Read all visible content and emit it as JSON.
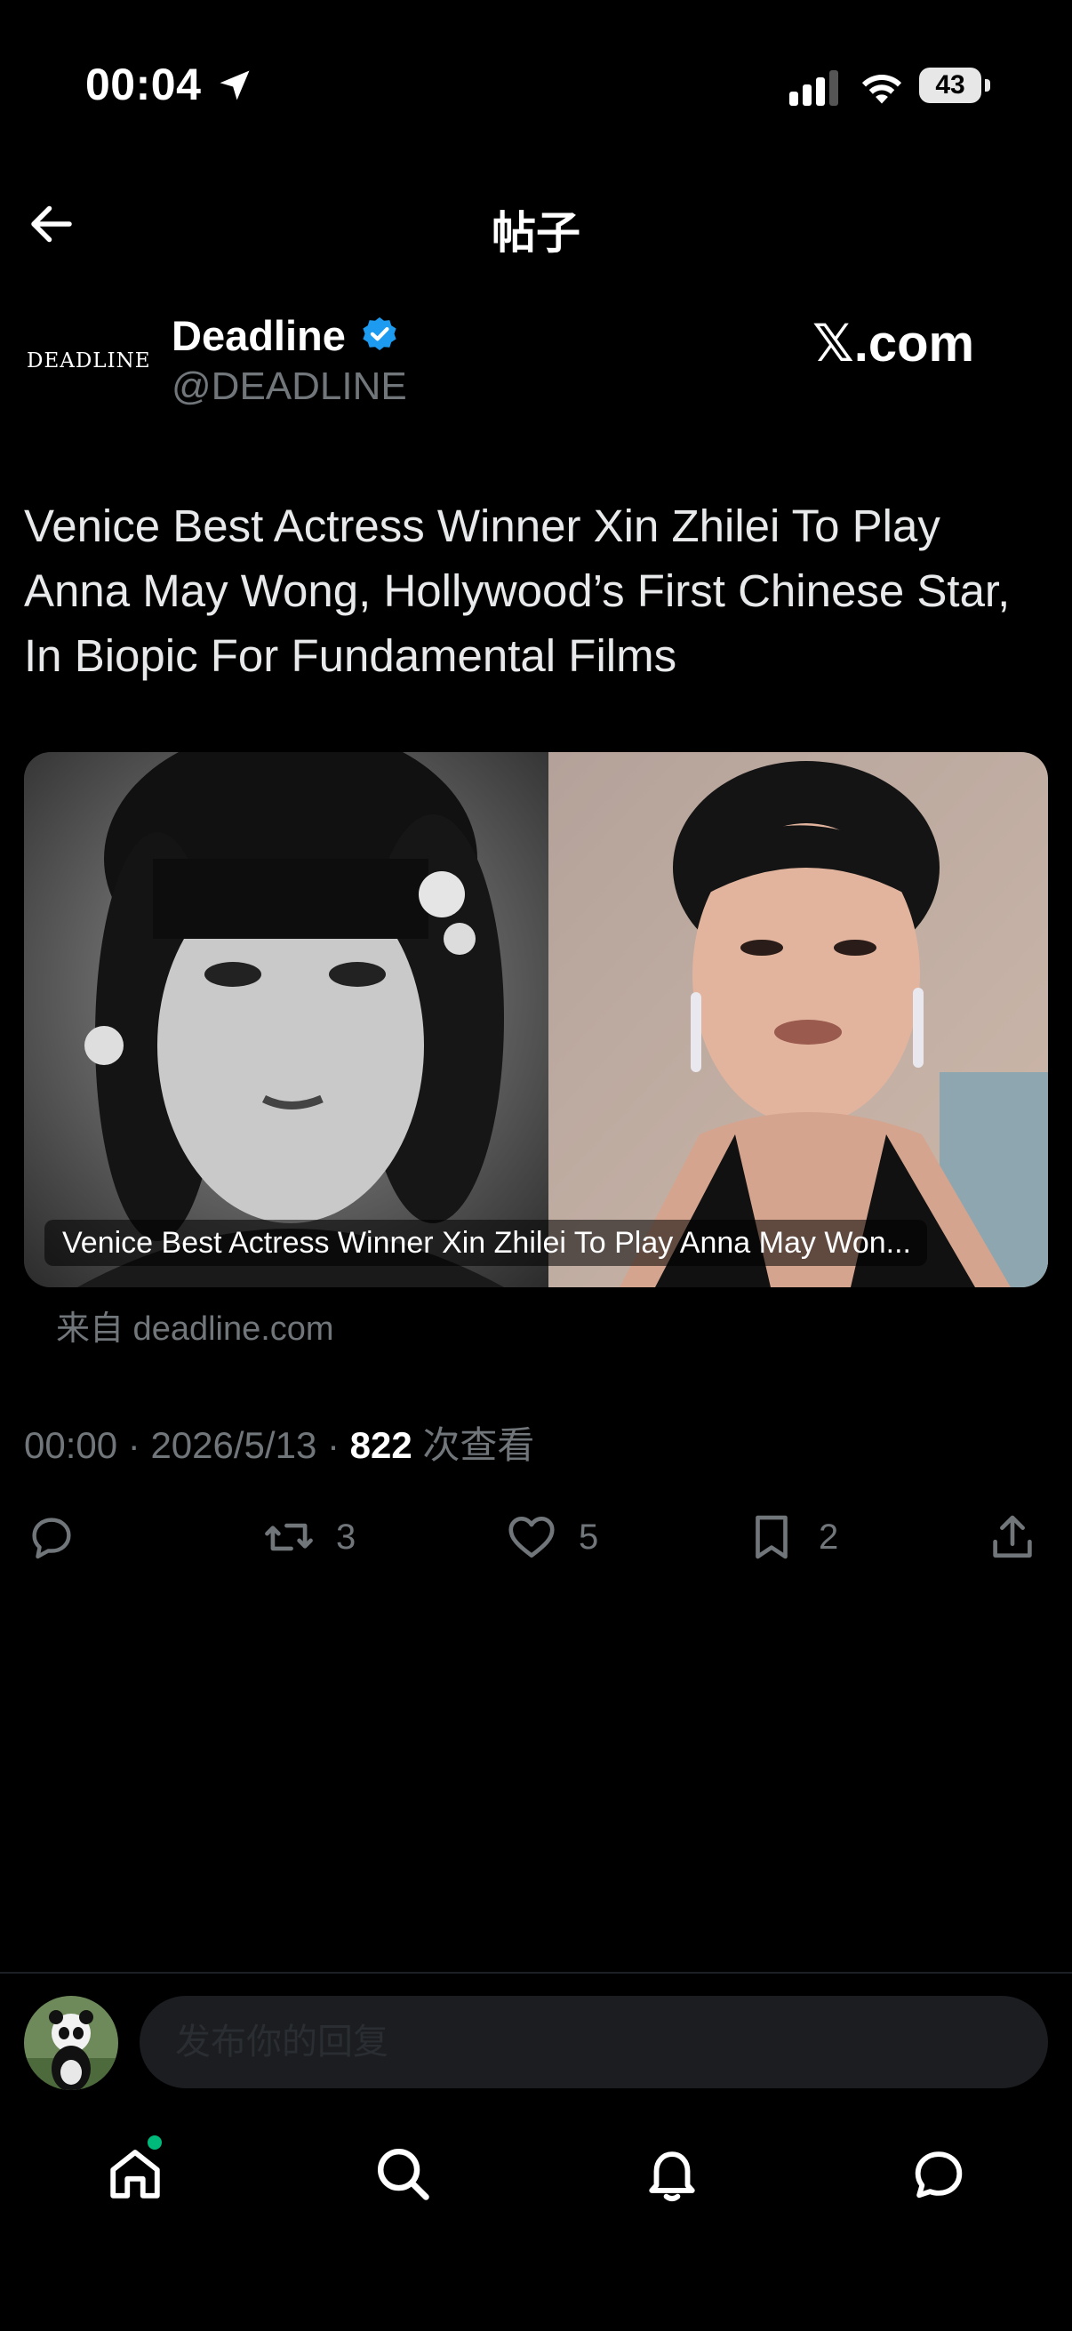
{
  "status_bar": {
    "time": "00:04",
    "battery": "43",
    "icons": [
      "location-arrow-icon",
      "signal-icon",
      "wifi-icon",
      "battery-icon"
    ]
  },
  "header": {
    "title": "帖子",
    "back_icon": "arrow-left-icon"
  },
  "author": {
    "logo_text": "DEADLINE",
    "name": "Deadline",
    "handle": "@DEADLINE",
    "verified": true,
    "badge_color": "#1d9bf0",
    "source_brand": "𝕏.com"
  },
  "tweet": {
    "text": "Venice Best Actress Winner Xin Zhilei To Play Anna May Wong, Hollywood’s First Chinese Star, In Biopic For Fundamental Films"
  },
  "card": {
    "caption": "Venice Best Actress Winner Xin Zhilei To Play Anna May Won...",
    "source": "来自 deadline.com",
    "images": [
      "black-and-white-portrait-photo",
      "color-portrait-photo"
    ]
  },
  "meta": {
    "time": "00:00",
    "separator": "·",
    "date": "2026/5/13",
    "views_count": "822",
    "views_label": "次查看"
  },
  "actions": {
    "reply_icon": "reply-icon",
    "retweet_count": "3",
    "like_count": "5",
    "bookmark_count": "2",
    "share_icon": "share-icon"
  },
  "composer": {
    "placeholder": "发布你的回复"
  },
  "bottom_nav": {
    "items": [
      {
        "icon": "home-icon",
        "active": true,
        "badge_color": "#00ba7c"
      },
      {
        "icon": "search-icon"
      },
      {
        "icon": "bell-icon"
      },
      {
        "icon": "message-icon"
      }
    ]
  },
  "colors": {
    "background": "#000000",
    "text": "#e7e9ea",
    "muted": "#71767b",
    "accent": "#1d9bf0"
  }
}
